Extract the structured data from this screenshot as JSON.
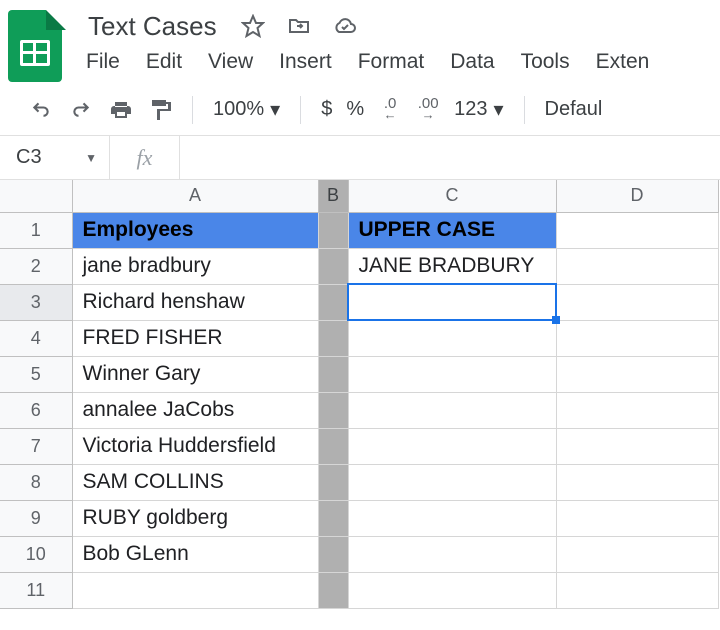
{
  "doc": {
    "title": "Text Cases"
  },
  "menu": {
    "file": "File",
    "edit": "Edit",
    "view": "View",
    "insert": "Insert",
    "format": "Format",
    "data": "Data",
    "tools": "Tools",
    "ext": "Exten"
  },
  "toolbar": {
    "zoom": "100%",
    "currency": "$",
    "percent": "%",
    "dec_dec": ".0",
    "dec_inc": ".00",
    "numfmt": "123",
    "font": "Defaul"
  },
  "namebox": {
    "ref": "C3"
  },
  "formula": {
    "label": "fx",
    "value": ""
  },
  "columns": {
    "A": "A",
    "B": "B",
    "C": "C",
    "D": "D"
  },
  "rows": [
    "1",
    "2",
    "3",
    "4",
    "5",
    "6",
    "7",
    "8",
    "9",
    "10",
    "11"
  ],
  "cells": {
    "A1": "Employees",
    "C1": "UPPER CASE",
    "A2": "jane bradbury",
    "C2": "JANE BRADBURY",
    "A3": "Richard henshaw",
    "A4": "FRED FISHER",
    "A5": "Winner Gary",
    "A6": "annalee JaCobs",
    "A7": "Victoria Huddersfield",
    "A8": "SAM COLLINS",
    "A9": "RUBY goldberg",
    "A10": "Bob GLenn"
  },
  "selection": {
    "cell": "C3"
  }
}
